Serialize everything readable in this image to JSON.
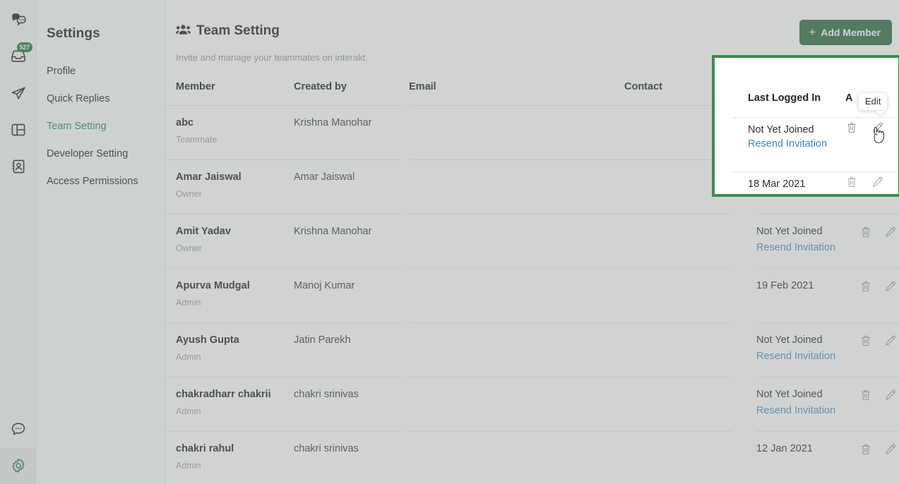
{
  "rail": {
    "icons": [
      {
        "name": "chats-icon",
        "badge": null
      },
      {
        "name": "inbox-icon",
        "badge": "527"
      },
      {
        "name": "send-icon",
        "badge": null
      },
      {
        "name": "layout-icon",
        "badge": null
      },
      {
        "name": "contacts-icon",
        "badge": null
      }
    ],
    "bottom_icons": [
      {
        "name": "help-chat-icon"
      },
      {
        "name": "gear-icon"
      }
    ],
    "badge_color": "#1f7a3d",
    "active_color": "#2e8b57"
  },
  "sidebar": {
    "title": "Settings",
    "items": [
      {
        "label": "Profile",
        "active": false
      },
      {
        "label": "Quick Replies",
        "active": false
      },
      {
        "label": "Team Setting",
        "active": true
      },
      {
        "label": "Developer Setting",
        "active": false
      },
      {
        "label": "Access Permissions",
        "active": false
      }
    ]
  },
  "page": {
    "title": "Team Setting",
    "subtitle": "Invite and manage your teammates on interakt.",
    "add_member_label": "Add Member",
    "add_member_plus": "+",
    "accent_green": "#2f6b41"
  },
  "table": {
    "columns": [
      "Member",
      "Created by",
      "Email",
      "Contact",
      "Last Logged In",
      "Action"
    ],
    "rows": [
      {
        "name": "abc",
        "role": "Teammate",
        "created_by": "Krishna Manohar",
        "email": "",
        "contact": "",
        "last_logged_in": "Not Yet Joined",
        "resend": "Resend Invitation"
      },
      {
        "name": "Amar Jaiswal",
        "role": "Owner",
        "created_by": "Amar Jaiswal",
        "email": "",
        "contact": "",
        "last_logged_in": "18 Mar 2021",
        "resend": ""
      },
      {
        "name": "Amit Yadav",
        "role": "Owner",
        "created_by": "Krishna Manohar",
        "email": "",
        "contact": "",
        "last_logged_in": "Not Yet Joined",
        "resend": "Resend Invitation"
      },
      {
        "name": "Apurva Mudgal",
        "role": "Admin",
        "created_by": "Manoj Kumar",
        "email": "",
        "contact": "",
        "last_logged_in": "19 Feb 2021",
        "resend": ""
      },
      {
        "name": "Ayush Gupta",
        "role": "Admin",
        "created_by": "Jatin Parekh",
        "email": "",
        "contact": "",
        "last_logged_in": "Not Yet Joined",
        "resend": "Resend Invitation"
      },
      {
        "name": "chakradharr chakrii",
        "role": "Admin",
        "created_by": "chakri srinivas",
        "email": "",
        "contact": "",
        "last_logged_in": "Not Yet Joined",
        "resend": "Resend Invitation"
      },
      {
        "name": "chakri rahul",
        "role": "Admin",
        "created_by": "chakri srinivas",
        "email": "",
        "contact": "",
        "last_logged_in": "12 Jan 2021",
        "resend": ""
      }
    ],
    "action_icons": [
      "delete-icon",
      "edit-icon"
    ],
    "link_color": "#4a90c4"
  },
  "highlight": {
    "border_color": "#3d8b4f",
    "header_last_logged": "Last Logged In",
    "header_action_truncated": "A",
    "row1_status": "Not Yet Joined",
    "row1_resend": "Resend Invitation",
    "row2_status": "18 Mar 2021"
  },
  "tooltip": {
    "label": "Edit"
  },
  "cursor": {
    "name": "pointer-hand-cursor"
  }
}
